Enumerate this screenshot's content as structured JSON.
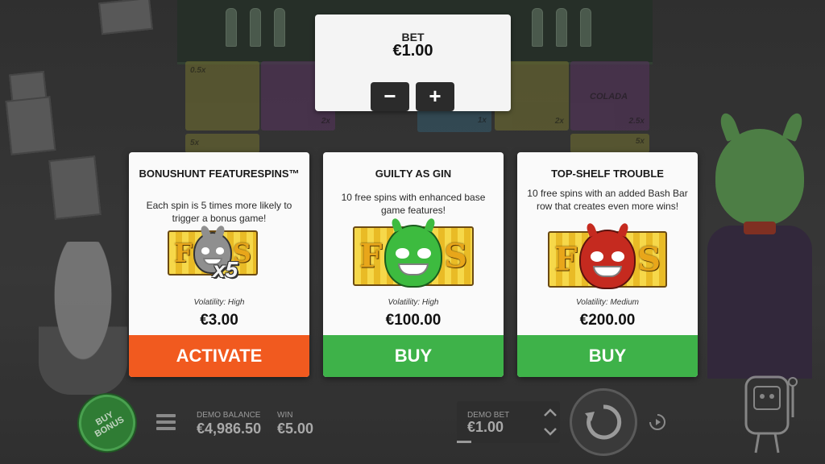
{
  "bet": {
    "label": "BET",
    "amount": "€1.00",
    "minus_label": "−",
    "plus_label": "+"
  },
  "cards": [
    {
      "title": "BONUSHUNT FEATURESPINS™",
      "description": "Each spin is 5 times more likely to trigger a bonus game!",
      "tile_left": "F",
      "tile_right": "S",
      "multiplier": "x5",
      "volatility": "Volatility: High",
      "price": "€3.00",
      "action": "ACTIVATE",
      "action_color": "#f15a1f"
    },
    {
      "title": "GUILTY AS GIN",
      "description": "10 free spins with enhanced base game features!",
      "tile_left": "F",
      "tile_right": "S",
      "volatility": "Volatility: High",
      "price": "€100.00",
      "action": "BUY",
      "action_color": "#3eb249"
    },
    {
      "title": "TOP-SHELF TROUBLE",
      "description": "10 free spins with an added Bash Bar row that creates even more wins!",
      "tile_left": "F",
      "tile_right": "S",
      "volatility": "Volatility: Medium",
      "price": "€200.00",
      "action": "BUY",
      "action_color": "#3eb249"
    }
  ],
  "bottom": {
    "buy_bonus": "BUY BONUS",
    "balance_label": "DEMO BALANCE",
    "balance_value": "€4,986.50",
    "win_label": "WIN",
    "win_value": "€5.00",
    "demo_bet_label": "DEMO BET",
    "demo_bet_value": "€1.00"
  },
  "background": {
    "reel_multipliers": [
      "0.5x",
      "2x",
      "1x",
      "2x",
      "5x",
      "2.5x",
      "5x"
    ],
    "sign_text": "COLADA"
  },
  "icons": {
    "menu": "hamburger-menu-icon",
    "bet_up": "chevron-up-icon",
    "bet_down": "chevron-down-icon",
    "spin": "spin-arrows-icon",
    "autoplay": "autoplay-icon"
  }
}
